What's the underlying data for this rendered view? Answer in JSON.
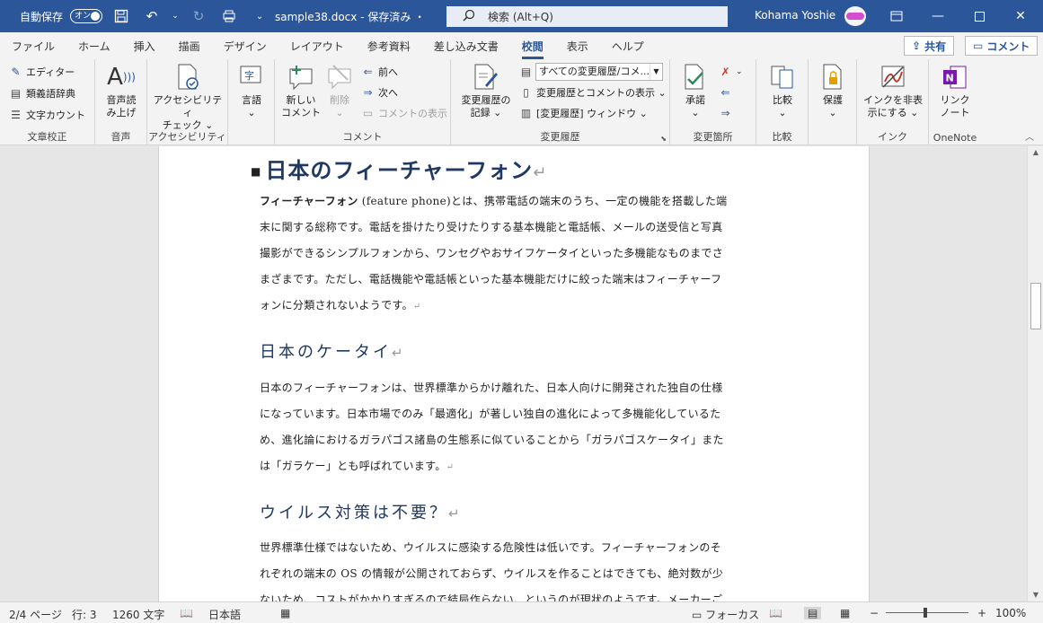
{
  "titlebar": {
    "autosave_label": "自動保存",
    "autosave_toggle": "オン",
    "doc_title": "sample38.docx - 保存済み ・",
    "search_placeholder": "検索 (Alt+Q)",
    "user_name": "Kohama Yoshie"
  },
  "tabs": [
    "ファイル",
    "ホーム",
    "挿入",
    "描画",
    "デザイン",
    "レイアウト",
    "参考資料",
    "差し込み文書",
    "校閲",
    "表示",
    "ヘルプ"
  ],
  "active_tab": "校閲",
  "actions": {
    "share": "共有",
    "comment": "コメント"
  },
  "ribbon": {
    "proofing": {
      "label": "文章校正",
      "editor": "エディター",
      "thesaurus": "類義語辞典",
      "word_count": "文字カウント"
    },
    "speech": {
      "label": "音声",
      "read_aloud_1": "音声読",
      "read_aloud_2": "み上げ"
    },
    "accessibility": {
      "label": "アクセシビリティ",
      "check_1": "アクセシビリティ",
      "check_2": "チェック ⌄"
    },
    "language": {
      "btn": "言語",
      "arrow": "⌄"
    },
    "comments": {
      "label": "コメント",
      "new_1": "新しい",
      "new_2": "コメント",
      "delete": "削除",
      "delete_arrow": "⌄",
      "prev": "前へ",
      "next": "次へ",
      "show": "コメントの表示"
    },
    "tracking": {
      "label": "変更履歴",
      "track_1": "変更履歴の",
      "track_2": "記録 ⌄",
      "markup_select": "すべての変更履歴/コメ...",
      "show_markup": "変更履歴とコメントの表示 ⌄",
      "pane": "[変更履歴] ウィンドウ  ⌄"
    },
    "changes": {
      "label": "変更箇所",
      "accept": "承諾",
      "accept_arrow": "⌄"
    },
    "compare": {
      "label": "比較",
      "btn": "比較",
      "arrow": "⌄"
    },
    "protect": {
      "btn": "保護",
      "arrow": "⌄"
    },
    "ink": {
      "label": "インク",
      "hide_1": "インクを非表",
      "hide_2": "示にする ⌄"
    },
    "onenote": {
      "label": "OneNote",
      "link_1": "リンク",
      "link_2": "ノート"
    }
  },
  "document": {
    "h1": "日本のフィーチャーフォン",
    "p1_lead": "フィーチャーフォン",
    "p1_lines": [
      " (feature phone)とは、携帯電話の端末のうち、一定の機能を搭載した端",
      "末に関する総称です。電話を掛けたり受けたりする基本機能と電話帳、メールの送受信と写真",
      "撮影ができるシンプルフォンから、ワンセグやおサイフケータイといった多機能なものまでさ",
      "まざまです。ただし、電話機能や電話帳といった基本機能だけに絞った端末はフィーチャーフ",
      "ォンに分類されないようです。"
    ],
    "h2a": "日本のケータイ",
    "p2_lines": [
      "日本のフィーチャーフォンは、世界標準からかけ離れた、日本人向けに開発された独自の仕様",
      "になっています。日本市場でのみ「最適化」が著しい独自の進化によって多機能化しているた",
      "め、進化論におけるガラパゴス諸島の生態系に似ていることから「ガラパゴスケータイ」また",
      "は「ガラケー」とも呼ばれています。"
    ],
    "h2b": "ウイルス対策は不要？",
    "p3_lines": [
      "世界標準仕様ではないため、ウイルスに感染する危険性は低いです。フィーチャーフォンのそ",
      "れぞれの端末の OS の情報が公開されておらず、ウイルスを作ることはできても、絶対数が少",
      "ないため、コストがかかりすぎるので結局作らない、というのが現状のようです。メーカーご"
    ],
    "para_mark": "↵"
  },
  "statusbar": {
    "page": "2/4 ページ",
    "line": "行: 3",
    "chars": "1260 文字",
    "lang": "日本語",
    "focus": "フォーカス",
    "zoom": "100%",
    "zoom_minus": "−",
    "zoom_plus": "+"
  },
  "colors": {
    "brand": "#2b579a",
    "heading": "#1f3864"
  }
}
